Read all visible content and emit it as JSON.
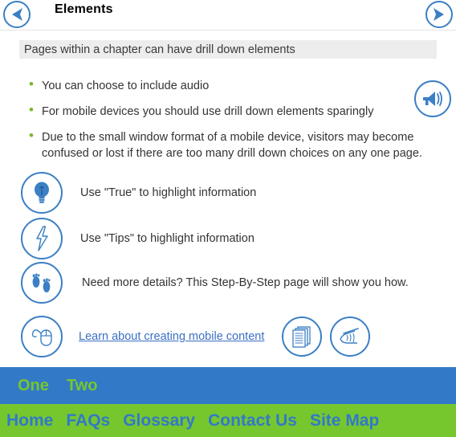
{
  "header": {
    "title": "Elements",
    "prev_icon": "arrow-left-icon",
    "next_icon": "arrow-right-icon"
  },
  "subtitle": {
    "text": "Pages within a chapter can have drill down elements"
  },
  "bullets": {
    "marker": "•",
    "items": [
      "You can choose to include audio",
      "For mobile devices you should use drill down elements sparingly",
      "Due to the small window format of a mobile device, visitors may become confused or lost if there are too many drill down choices on any one page."
    ]
  },
  "audio": {
    "icon": "megaphone-icon"
  },
  "icon_rows": [
    {
      "icon": "lightbulb-icon",
      "text": "Use \"True\" to highlight information"
    },
    {
      "icon": "lightning-icon",
      "text": "Use \"Tips\" to highlight information"
    },
    {
      "icon": "footprints-icon",
      "text": "Need more details? This Step-By-Step page will show you how."
    }
  ],
  "link_row": {
    "icon": "mouse-icon",
    "link_text": "Learn about creating mobile content",
    "extra_icons": [
      {
        "name": "documents-stack-icon"
      },
      {
        "name": "hand-writing-icon"
      }
    ]
  },
  "tab_bar": {
    "items": [
      {
        "label": "One"
      },
      {
        "label": "Two"
      }
    ]
  },
  "footer_bar": {
    "items": [
      {
        "label": "Home"
      },
      {
        "label": "FAQs"
      },
      {
        "label": "Glossary"
      },
      {
        "label": "Contact Us"
      },
      {
        "label": "Site Map"
      }
    ]
  },
  "colors": {
    "brand_blue": "#3279c8",
    "brand_green": "#76c72e",
    "icon_blue": "#3b7fc4",
    "subtitle_bg": "#ededed",
    "link_blue": "#3b6fc4",
    "bullet_green": "#76b82a"
  }
}
